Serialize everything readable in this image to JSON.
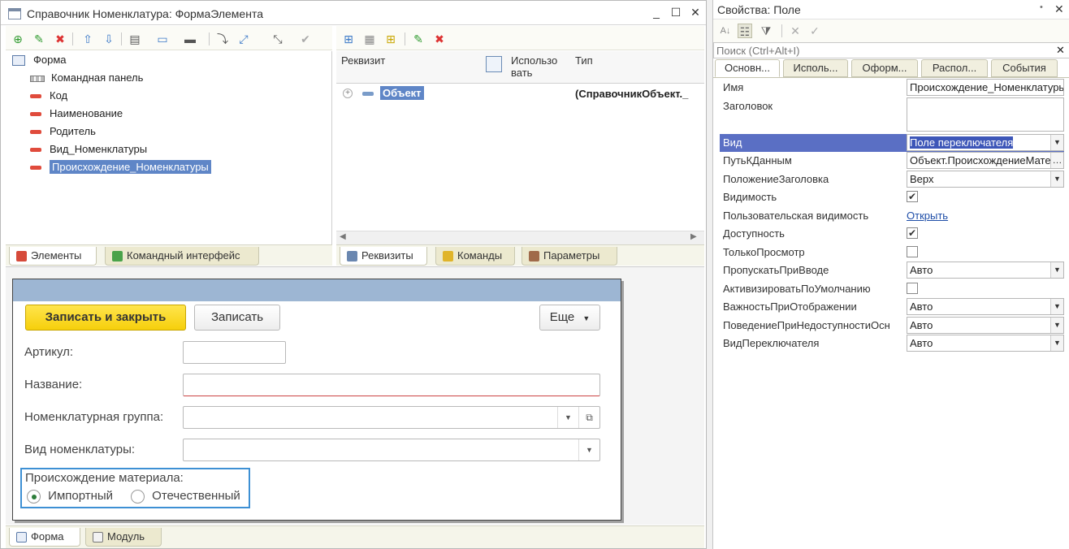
{
  "window": {
    "title": "Справочник Номенклатура: ФормаЭлемента",
    "minimize": "_",
    "maximize": "☐",
    "close": "✕"
  },
  "tree": {
    "root": "Форма",
    "items": [
      {
        "label": "Командная панель",
        "icon": "command-panel-icon"
      },
      {
        "label": "Код",
        "icon": "field-icon"
      },
      {
        "label": "Наименование",
        "icon": "field-icon"
      },
      {
        "label": "Родитель",
        "icon": "field-icon"
      },
      {
        "label": "Вид_Номенклатуры",
        "icon": "field-icon"
      },
      {
        "label": "Происхождение_Номенклатуры",
        "icon": "field-icon",
        "selected": true
      }
    ]
  },
  "left_tabs": [
    "Элементы",
    "Командный интерфейс"
  ],
  "attributes": {
    "columns": [
      "Реквизит",
      "Использо\nвать",
      "Тип"
    ],
    "rows": [
      {
        "name": "Объект",
        "type": "(СправочникОбъект._"
      }
    ]
  },
  "middle_tabs": [
    "Реквизиты",
    "Команды",
    "Параметры"
  ],
  "preview": {
    "save_close": "Записать и закрыть",
    "save": "Записать",
    "more": "Еще",
    "fields": {
      "article": "Артикул:",
      "name": "Название:",
      "group": "Номенклатурная группа:",
      "kind": "Вид номенклатуры:"
    },
    "origin_label": "Происхождение материала:",
    "origin_options": [
      "Импортный",
      "Отечественный"
    ],
    "origin_selected": "Импортный"
  },
  "bottom_tabs": [
    "Форма",
    "Модуль"
  ],
  "props": {
    "title": "Свойства: Поле",
    "search_placeholder": "Поиск (Ctrl+Alt+I)",
    "tabs": [
      "Основн...",
      "Исполь...",
      "Оформ...",
      "Распол...",
      "События"
    ],
    "rows": [
      {
        "name": "Имя",
        "value": "Происхождение_Номенклатуры",
        "kind": "text"
      },
      {
        "name": "Заголовок",
        "value": "",
        "kind": "area"
      },
      {
        "name": "Вид",
        "value": "Поле переключателя",
        "kind": "select",
        "selected": true
      },
      {
        "name": "ПутьКДанным",
        "value": "Объект.ПроисхождениеМатериала",
        "kind": "path"
      },
      {
        "name": "ПоложениеЗаголовка",
        "value": "Верх",
        "kind": "select"
      },
      {
        "name": "Видимость",
        "value": "✔",
        "kind": "check"
      },
      {
        "name": "Пользовательская видимость",
        "value": "Открыть",
        "kind": "link"
      },
      {
        "name": "Доступность",
        "value": "✔",
        "kind": "check"
      },
      {
        "name": "ТолькоПросмотр",
        "value": "",
        "kind": "check"
      },
      {
        "name": "ПропускатьПриВводе",
        "value": "Авто",
        "kind": "select"
      },
      {
        "name": "АктивизироватьПоУмолчанию",
        "value": "",
        "kind": "check"
      },
      {
        "name": "ВажностьПриОтображении",
        "value": "Авто",
        "kind": "select"
      },
      {
        "name": "ПоведениеПриНедоступностиОсн",
        "value": "Авто",
        "kind": "select"
      },
      {
        "name": "ВидПереключателя",
        "value": "Авто",
        "kind": "select"
      }
    ]
  },
  "colors": {
    "selection": "#5f86c7",
    "accent_yellow": "#f6cf0b",
    "form_header": "#9db6d3"
  }
}
